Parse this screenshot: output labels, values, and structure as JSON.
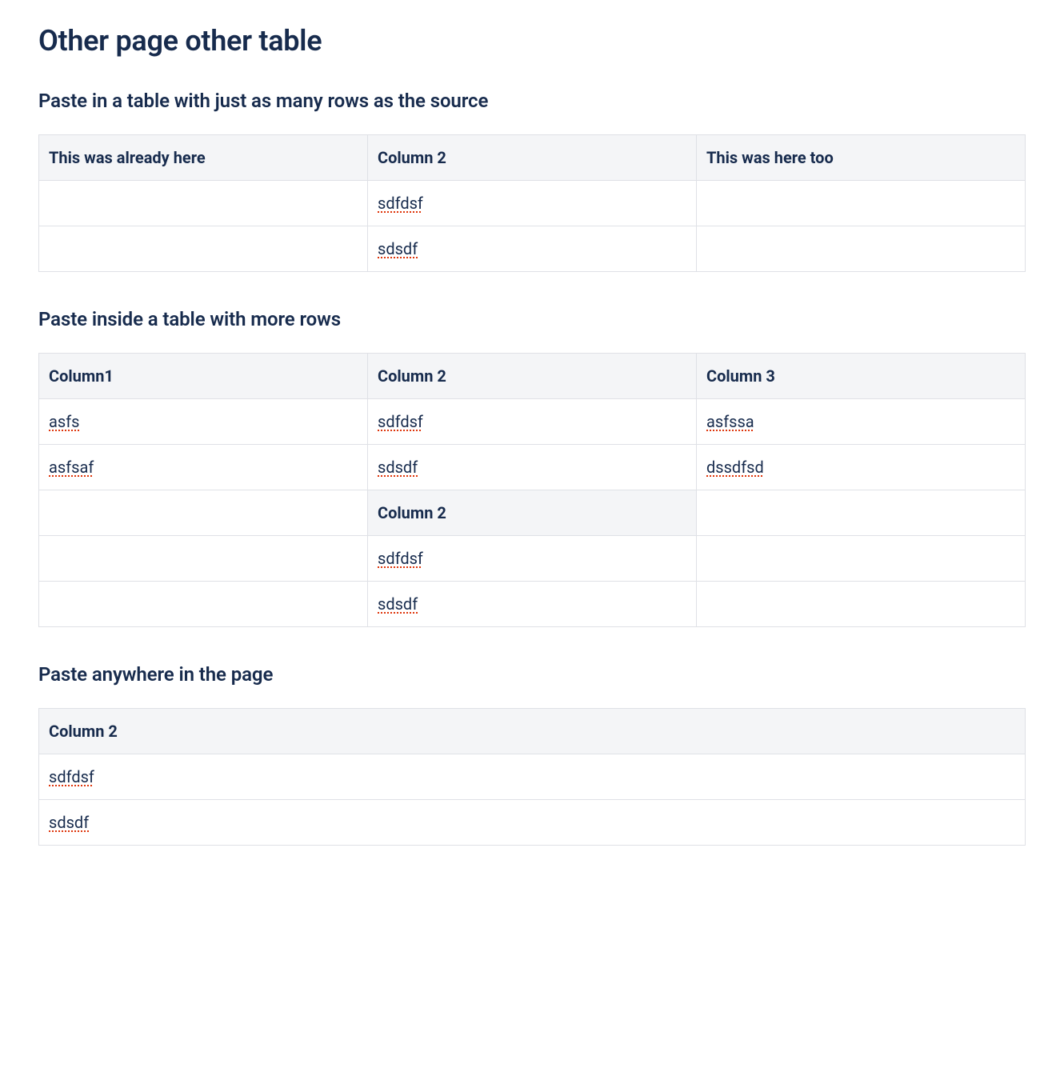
{
  "page_title": "Other page other table",
  "section1": {
    "heading": "Paste in a table with just as many rows as the source",
    "headers": [
      "This was already here",
      "Column 2",
      "This was here too"
    ],
    "rows": [
      [
        "",
        "sdfdsf",
        ""
      ],
      [
        "",
        "sdsdf",
        ""
      ]
    ]
  },
  "section2": {
    "heading": "Paste inside a table with more rows",
    "headers": [
      "Column1",
      "Column 2",
      "Column 3"
    ],
    "rows": [
      {
        "cells": [
          "asfs",
          "sdfdsf",
          "asfssa"
        ],
        "header_cols": []
      },
      {
        "cells": [
          "asfsaf",
          "sdsdf",
          "dssdfsd"
        ],
        "header_cols": []
      },
      {
        "cells": [
          "",
          "Column 2",
          ""
        ],
        "header_cols": [
          1
        ]
      },
      {
        "cells": [
          "",
          "sdfdsf",
          ""
        ],
        "header_cols": []
      },
      {
        "cells": [
          "",
          "sdsdf",
          ""
        ],
        "header_cols": []
      }
    ]
  },
  "section3": {
    "heading": "Paste anywhere in the page",
    "headers": [
      "Column 2"
    ],
    "rows": [
      [
        "sdfdsf"
      ],
      [
        "sdsdf"
      ]
    ]
  }
}
